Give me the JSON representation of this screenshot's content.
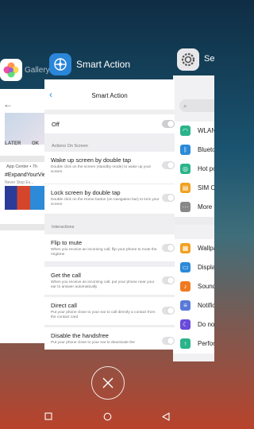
{
  "gallery": {
    "title": "Gallery",
    "later": "LATER",
    "ok": "OK",
    "app_center": "App Center • 7h",
    "hashtag": "#ExpandYourVie",
    "never": "Never Stop Ex..."
  },
  "settings": {
    "title": "Se",
    "items": [
      {
        "label": "WLAN",
        "color": "#2bb38a"
      },
      {
        "label": "Blueto",
        "color": "#2c8ad8"
      },
      {
        "label": "Hot po",
        "color": "#2bb38a"
      },
      {
        "label": "SIM Ca",
        "color": "#f0a020"
      },
      {
        "label": "More",
        "color": "#888888"
      },
      {
        "label": "Wallpa",
        "color": "#f0a020"
      },
      {
        "label": "Displa",
        "color": "#2c8ad8"
      },
      {
        "label": "Sound",
        "color": "#f07a20"
      },
      {
        "label": "Notific",
        "color": "#5a7ad8"
      },
      {
        "label": "Do not",
        "color": "#6a4ad8"
      },
      {
        "label": "Perfor",
        "color": "#2bb38a"
      }
    ]
  },
  "smart_action": {
    "app_title": "Smart Action",
    "header_title": "Smart Action",
    "master_label": "Off",
    "section_on_screen": "Actions On Screen",
    "section_interactions": "Interactions",
    "options": [
      {
        "title": "Wake up screen by double tap",
        "desc": "Double click on the screen (standby mode) to wake up your screen"
      },
      {
        "title": "Lock screen by double tap",
        "desc": "Double click on the Home button (on navigation bar) to lock your screen"
      },
      {
        "title": "Flip to mute",
        "desc": "When you receive an incoming call, flip your phone to mute the ringtone"
      },
      {
        "title": "Get the call",
        "desc": "When you receive an incoming call, put your phone near your ear to answer automatically"
      },
      {
        "title": "Direct call",
        "desc": "Put your phone close to your ear to call directly a contact from the contact card"
      },
      {
        "title": "Disable the handsfree",
        "desc": "Put your phone close to your ear to deactivate the"
      }
    ]
  }
}
